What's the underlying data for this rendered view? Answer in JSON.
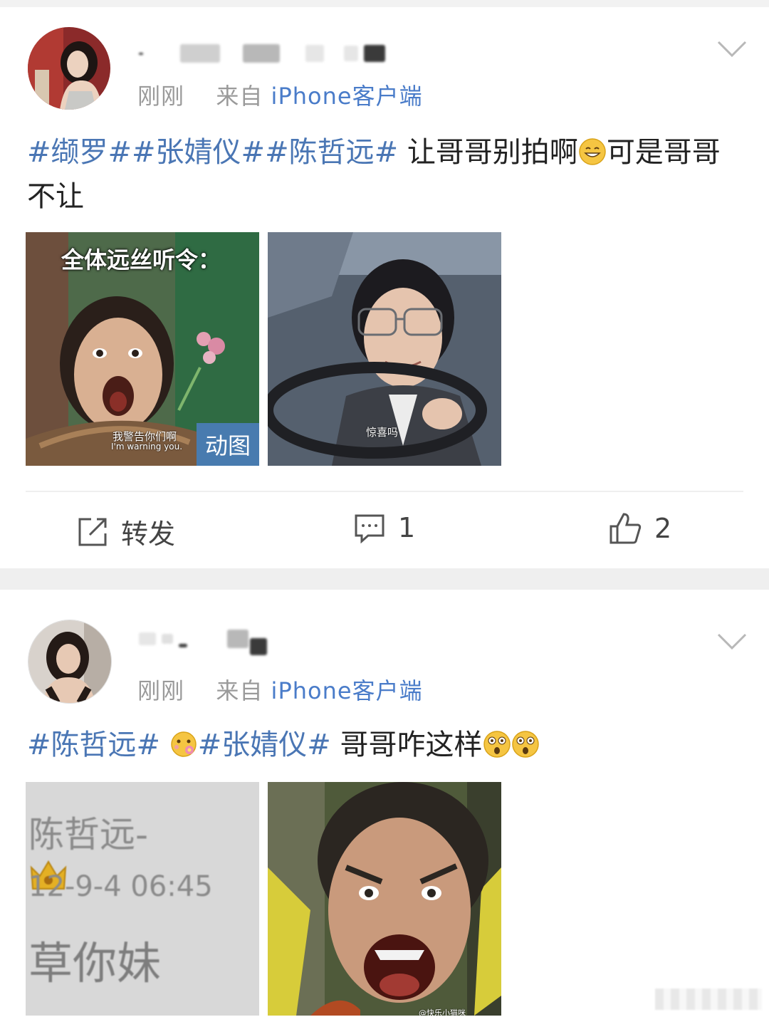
{
  "posts": [
    {
      "time": "刚刚",
      "source_prefix": "来自",
      "source": "iPhone客户端",
      "text": {
        "tags": [
          "#缬罗#",
          "#张婧仪#",
          "#陈哲远#"
        ],
        "body": "让哥哥别拍啊",
        "body_after_emoji": "可是哥哥不让"
      },
      "images": [
        {
          "caption_top": "全体远丝听令：",
          "caption_cn": "我警告你们啊",
          "caption_en": "I'm warning you.",
          "badge": "动图"
        },
        {
          "caption_cn": "惊喜吗"
        }
      ],
      "actions": {
        "repost_label": "转发",
        "comment_count": "1",
        "like_count": "2"
      }
    },
    {
      "time": "刚刚",
      "source_prefix": "来自",
      "source": "iPhone客户端",
      "text": {
        "tags_a": [
          "#陈哲远#"
        ],
        "tags_b": [
          "#张婧仪#"
        ],
        "body": "哥哥咋这样"
      },
      "images": [
        {
          "line1": "陈哲远-",
          "line2": "12-9-4 06:45",
          "line3": "草你妹"
        },
        {
          "watermark": "@快乐小猫咪"
        }
      ]
    }
  ],
  "colors": {
    "tag": "#4a76b4",
    "source": "#4a7cc9",
    "meta": "#9a9a9a",
    "badge": "#4b7db9"
  },
  "icons": [
    "chevron-down-icon",
    "share-icon",
    "comment-icon",
    "like-icon",
    "grin-emoji",
    "flower-emoji",
    "surprised-emoji"
  ]
}
